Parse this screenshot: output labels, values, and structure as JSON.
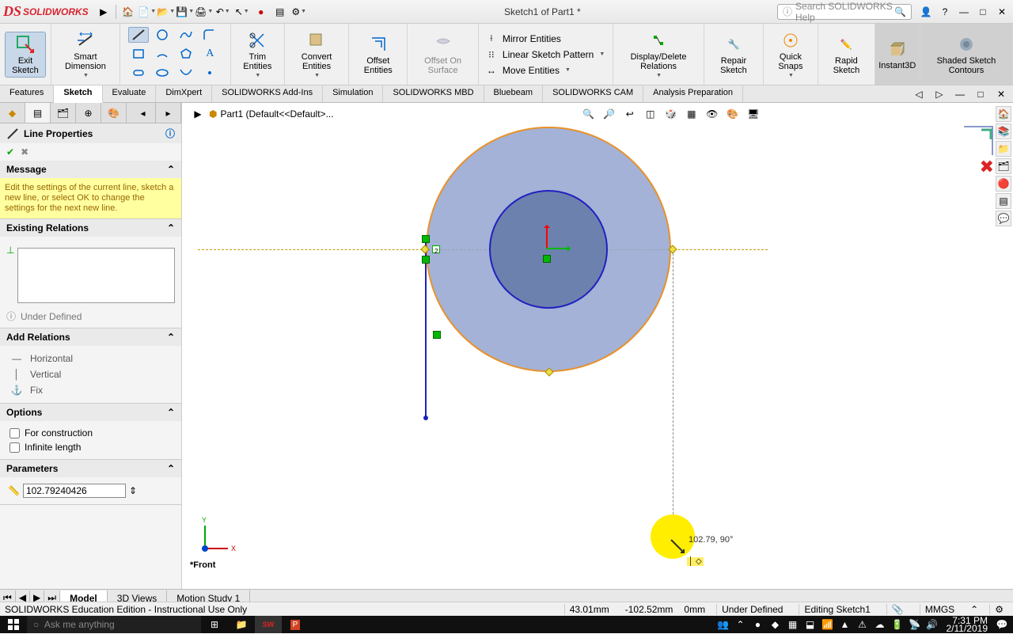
{
  "app": {
    "name": "SOLIDWORKS",
    "doc_title": "Sketch1 of Part1 *",
    "search_placeholder": "Search SOLIDWORKS Help"
  },
  "ribbon": {
    "exit_sketch": "Exit Sketch",
    "smart_dim": "Smart Dimension",
    "trim": "Trim Entities",
    "convert": "Convert Entities",
    "offset": "Offset Entities",
    "offset_surf": "Offset On Surface",
    "mirror": "Mirror Entities",
    "linear": "Linear Sketch Pattern",
    "move": "Move Entities",
    "display_del": "Display/Delete Relations",
    "repair": "Repair Sketch",
    "quick_snaps": "Quick Snaps",
    "rapid": "Rapid Sketch",
    "instant3d": "Instant3D",
    "shaded": "Shaded Sketch Contours"
  },
  "tabs": [
    "Features",
    "Sketch",
    "Evaluate",
    "DimXpert",
    "SOLIDWORKS Add-Ins",
    "Simulation",
    "SOLIDWORKS MBD",
    "Bluebeam",
    "SOLIDWORKS CAM",
    "Analysis Preparation"
  ],
  "tabs_active": 1,
  "breadcrumb": "Part1  (Default<<Default>...",
  "panel": {
    "title": "Line Properties",
    "msg_head": "Message",
    "msg_body": "Edit the settings of the current line, sketch a new line, or select OK to change the settings for the next new line.",
    "existing": "Existing Relations",
    "under": "Under Defined",
    "add": "Add Relations",
    "rel_h": "Horizontal",
    "rel_v": "Vertical",
    "rel_f": "Fix",
    "options": "Options",
    "opt_c": "For construction",
    "opt_i": "Infinite length",
    "params": "Parameters",
    "param_val": "102.79240426"
  },
  "viewport": {
    "label": "*Front",
    "cursor_tip": "102.79, 90°"
  },
  "bottom_tabs": [
    "Model",
    "3D Views",
    "Motion Study 1"
  ],
  "status": {
    "edition": "SOLIDWORKS Education Edition - Instructional Use Only",
    "x": "43.01mm",
    "y": "-102.52mm",
    "z": "0mm",
    "def": "Under Defined",
    "mode": "Editing Sketch1",
    "units": "MMGS"
  },
  "taskbar": {
    "search": "Ask me anything",
    "time": "7:31 PM",
    "date": "2/11/2019"
  }
}
